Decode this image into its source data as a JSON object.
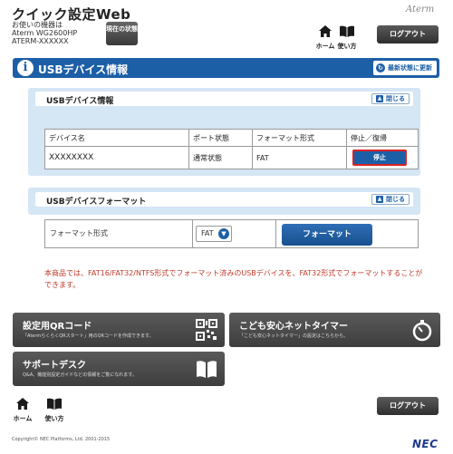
{
  "header": {
    "title": "クイック設定Web",
    "device_label": "お使いの機器は",
    "device_model": "Aterm WG2600HP",
    "device_id": "ATERM-XXXXXX",
    "state_button": "現在の状態",
    "brand": "Aterm",
    "home_label": "ホーム",
    "usage_label": "使い方",
    "logout_label": "ログアウト"
  },
  "page": {
    "title": "USBデバイス情報",
    "refresh_label": "最新状態に更新"
  },
  "device_section": {
    "title": "USBデバイス情報",
    "close_label": "閉じる",
    "columns": [
      "デバイス名",
      "ポート状態",
      "フォーマット形式",
      "停止／復帰"
    ],
    "rows": [
      {
        "name": "XXXXXXXX",
        "port_state": "通常状態",
        "format": "FAT",
        "action": "停止"
      }
    ]
  },
  "format_section": {
    "title": "USBデバイスフォーマット",
    "close_label": "閉じる",
    "field_label": "フォーマット形式",
    "selected_format": "FAT",
    "format_button": "フォーマット"
  },
  "note": "本商品では、FAT16/FAT32/NTFS形式でフォーマット済みのUSBデバイスを、FAT32形式でフォーマットすることができます。",
  "tiles": {
    "qr": {
      "title": "設定用QRコード",
      "desc": "「AtermらくらくQRスタート」用のQRコードを作成できます。"
    },
    "kids": {
      "title": "こども安心ネットタイマー",
      "desc": "「こども安心ネットタイマー」の設定はこちらから。"
    },
    "support": {
      "title": "サポートデスク",
      "desc": "Q&A、機能別設定ガイドなどの情報をご覧になれます。"
    }
  },
  "footer": {
    "home_label": "ホーム",
    "usage_label": "使い方",
    "logout_label": "ログアウト",
    "copyright": "Copyright© NEC Platforms, Ltd. 2001-2015",
    "logo": "NEC"
  },
  "colors": {
    "accent": "#1d5fa6",
    "panel": "#d5e6f5",
    "note": "#c0392b",
    "tile": "#4a4a4a"
  }
}
